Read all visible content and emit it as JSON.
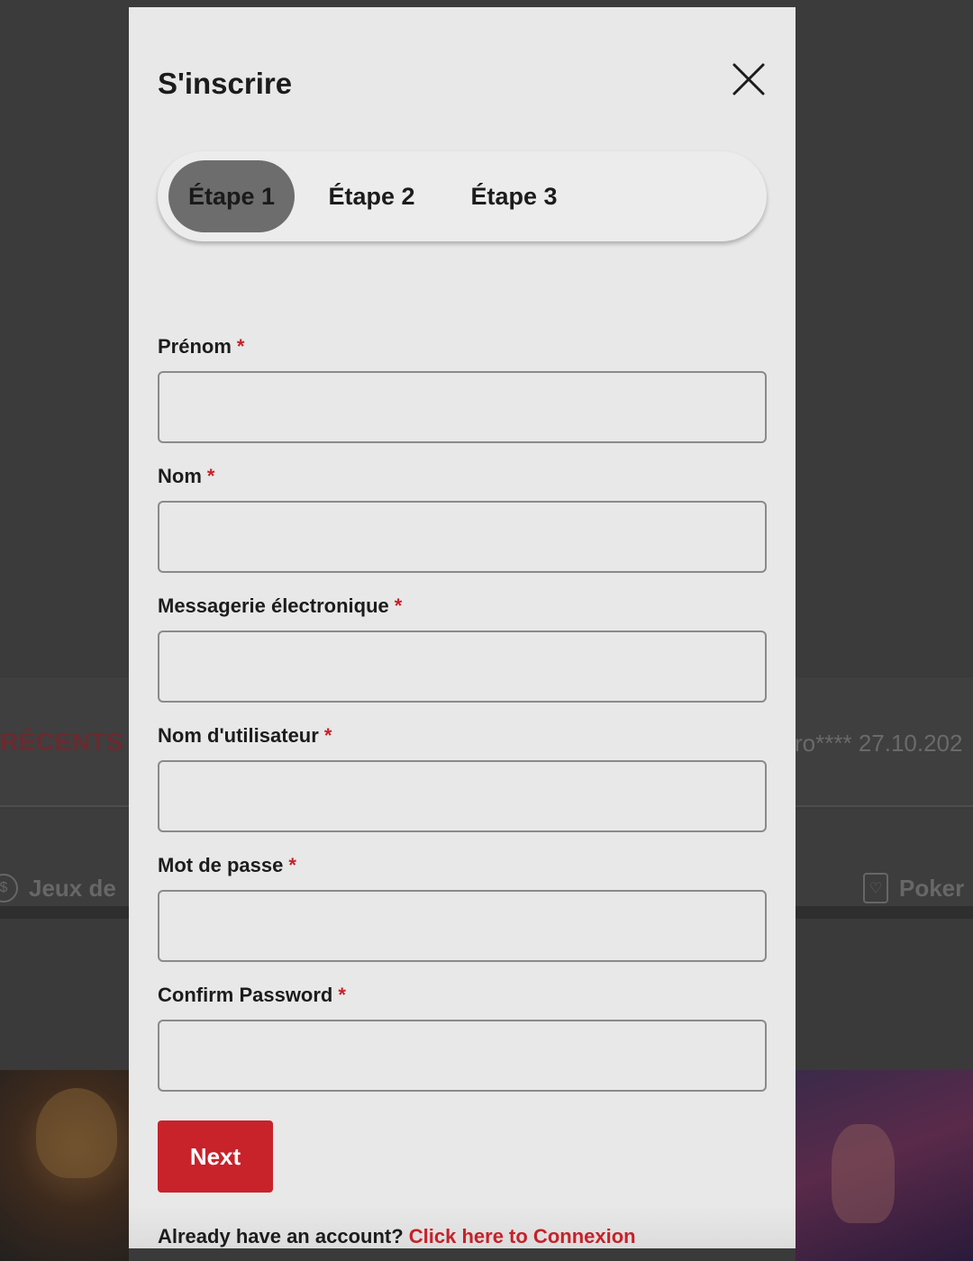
{
  "background": {
    "ticker_label": "RÉCENTS",
    "ticker_text": "ro**** 27.10.202",
    "categories": [
      {
        "label": "Jeux de",
        "icon": "dollar-coin-icon"
      },
      {
        "label": "Poker",
        "icon": "playing-card-icon"
      }
    ]
  },
  "modal": {
    "title": "S'inscrire",
    "close_icon": "close-icon",
    "steps": [
      {
        "label": "Étape 1",
        "active": true
      },
      {
        "label": "Étape 2",
        "active": false
      },
      {
        "label": "Étape 3",
        "active": false
      }
    ],
    "fields": [
      {
        "label": "Prénom",
        "required": "*",
        "value": "",
        "placeholder": ""
      },
      {
        "label": "Nom",
        "required": "*",
        "value": "",
        "placeholder": ""
      },
      {
        "label": "Messagerie électronique",
        "required": "*",
        "value": "",
        "placeholder": ""
      },
      {
        "label": "Nom d'utilisateur",
        "required": "*",
        "value": "",
        "placeholder": ""
      },
      {
        "label": "Mot de passe",
        "required": "*",
        "value": "",
        "placeholder": ""
      },
      {
        "label": "Confirm Password",
        "required": "*",
        "value": "",
        "placeholder": ""
      }
    ],
    "next_label": "Next",
    "footer": {
      "prompt": "Already have an account?",
      "link": "Click here to Connexion"
    }
  },
  "colors": {
    "accent": "#c8222b",
    "overlay": "#3a3a3a",
    "modal_bg": "#e8e8e8",
    "active_step": "#6d6d6d"
  }
}
